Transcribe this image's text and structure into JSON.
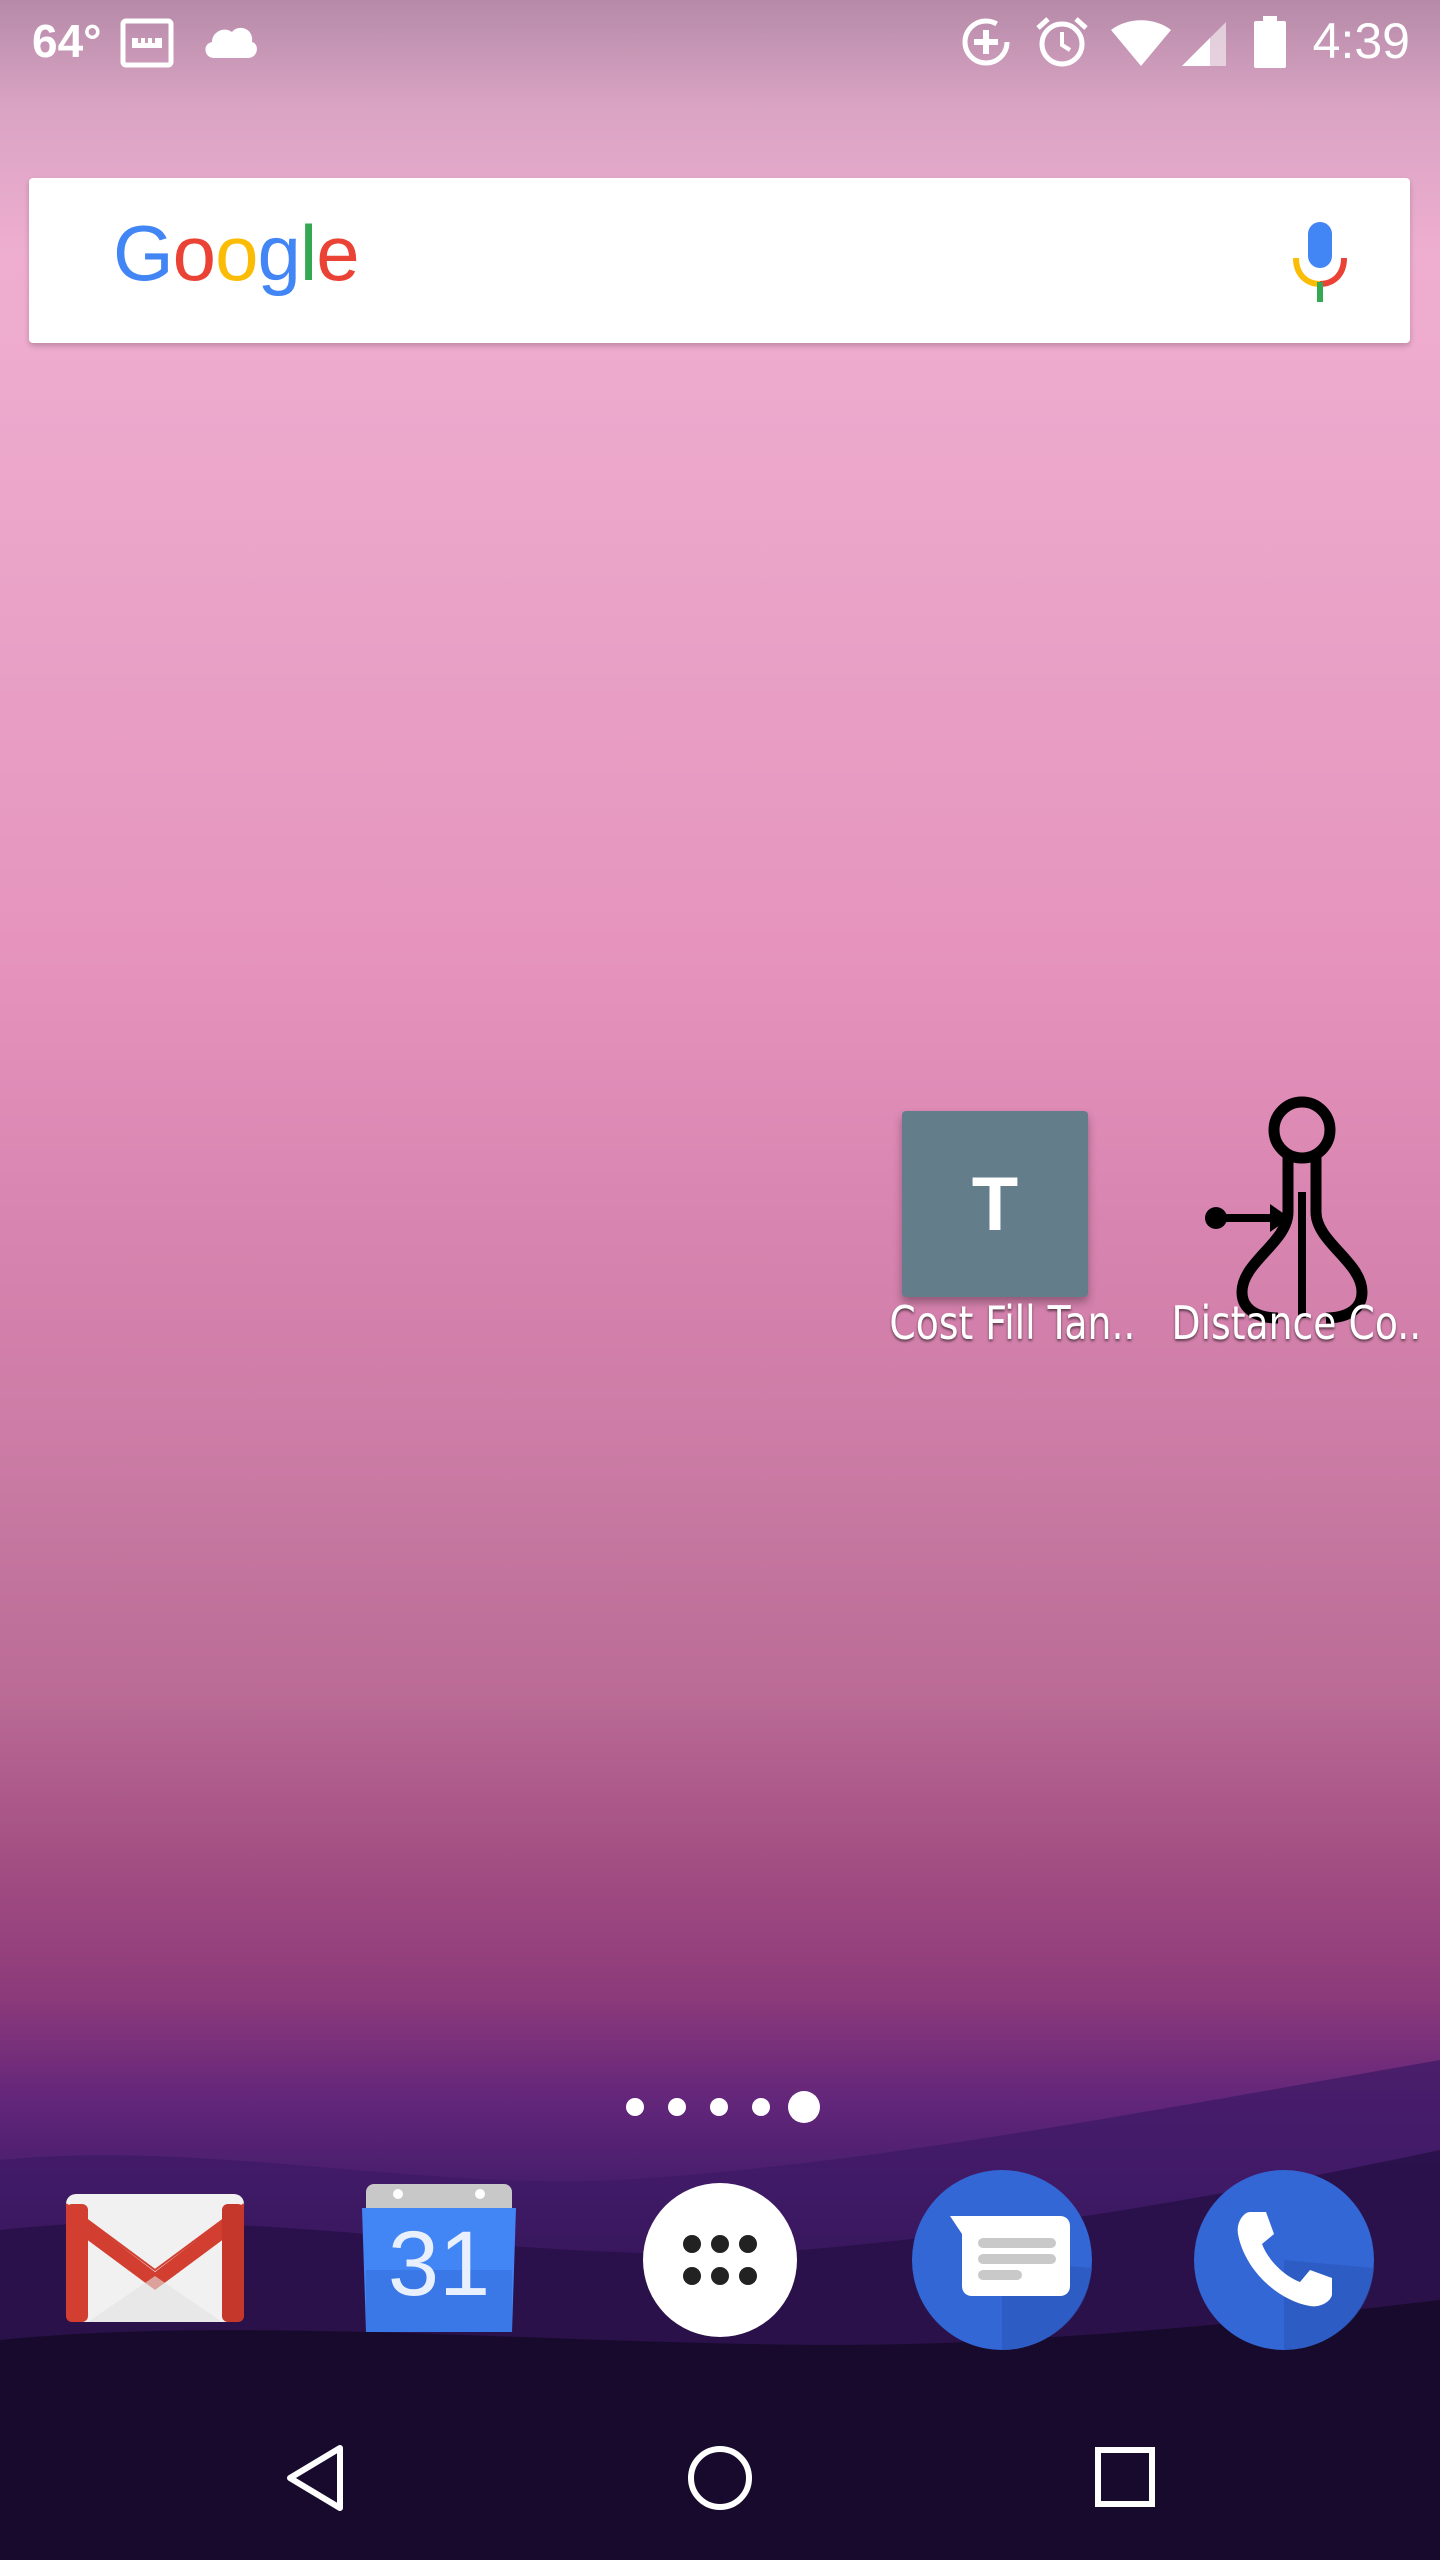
{
  "status_bar": {
    "temperature": "64°",
    "clock": "4:39",
    "left_icons": [
      "ruler-notification-icon",
      "cloud-icon"
    ],
    "right_icons": [
      "data-saver-icon",
      "alarm-icon",
      "wifi-icon",
      "cellular-signal-icon",
      "battery-icon"
    ]
  },
  "search_widget": {
    "logo_letters": [
      {
        "char": "G",
        "color": "#4285F4"
      },
      {
        "char": "o",
        "color": "#EA4335"
      },
      {
        "char": "o",
        "color": "#FBBC05"
      },
      {
        "char": "g",
        "color": "#4285F4"
      },
      {
        "char": "l",
        "color": "#34A853"
      },
      {
        "char": "e",
        "color": "#EA4335"
      }
    ],
    "mic_icon": "mic-icon"
  },
  "shortcuts": [
    {
      "label": "Cost Fill Tan..",
      "tile_letter": "T",
      "tile_color": "#647D8B"
    },
    {
      "label": "Distance Co..",
      "icon": "caliper-icon"
    }
  ],
  "page_indicator": {
    "count": 5,
    "active": 5
  },
  "dock": [
    {
      "app": "Gmail",
      "icon": "gmail-icon"
    },
    {
      "app": "Calendar",
      "icon": "calendar-icon",
      "day": "31"
    },
    {
      "app": "All apps",
      "icon": "app-drawer-icon"
    },
    {
      "app": "Messages",
      "icon": "messages-icon"
    },
    {
      "app": "Phone",
      "icon": "phone-icon"
    }
  ],
  "nav_bar": [
    "back-icon",
    "home-icon",
    "recents-icon"
  ],
  "colors": {
    "calendar_blue": "#4285F4",
    "messages_blue": "#3367D6",
    "gmail_red": "#D23F31"
  }
}
